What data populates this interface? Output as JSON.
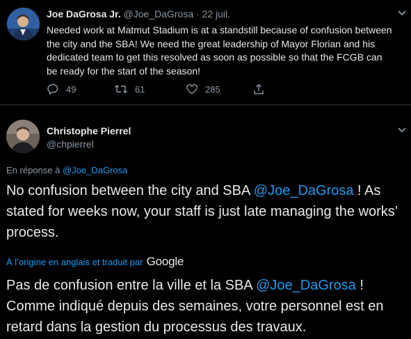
{
  "tweet1": {
    "name": "Joe DaGrosa Jr.",
    "handle": "@Joe_DaGrosa",
    "dot": "·",
    "date": "22 juil.",
    "text": "Needed work at Matmut Stadium is at a standstill because of confusion between the city and the SBA! We need the great leadership of Mayor Florian and his dedicated team to get this resolved as soon as possible so that the FCGB can be ready for the start of the season!",
    "reply_count": "49",
    "retweet_count": "61",
    "like_count": "285",
    "icons": [
      "reply-icon",
      "retweet-icon",
      "like-icon",
      "share-icon",
      "chevron-down-icon"
    ]
  },
  "tweet2": {
    "name": "Christophe Pierrel",
    "handle": "@chpierrel",
    "reply_prefix": "En réponse à",
    "reply_handle": "@Joe_DaGrosa",
    "text_before": "No confusion between the city and SBA ",
    "text_mention": "@Joe_DaGrosa",
    "text_after": " ! As stated for weeks now, your staff is just late managing the works’ process.",
    "translated_by": "À l’origine en anglais et traduit par",
    "google": "Google",
    "trans_before": "Pas de confusion entre la ville et la SBA ",
    "trans_mention": "@Joe_DaGrosa",
    "trans_after": " ! Comme indiqué depuis des semaines, votre personnel est en retard dans la gestion du processus des travaux."
  },
  "colors": {
    "background": "#000000",
    "text": "#e7e9ea",
    "muted": "#8b98a5",
    "link": "#1d9bf0"
  }
}
